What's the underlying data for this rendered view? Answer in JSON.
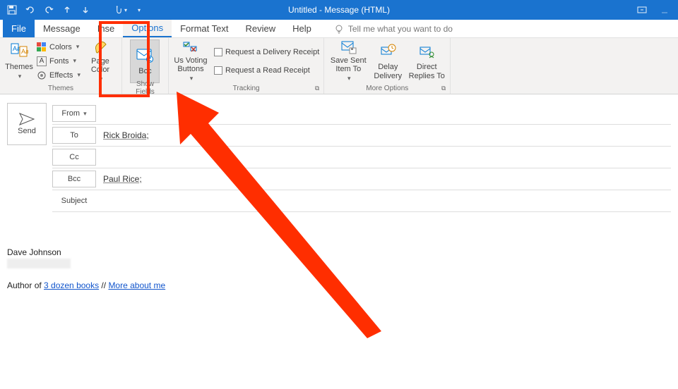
{
  "titlebar": {
    "title": "Untitled  -  Message (HTML)"
  },
  "tabs": {
    "file": "File",
    "message": "Message",
    "insert": "Inse",
    "options": "Options",
    "format": "Format Text",
    "review": "Review",
    "help": "Help",
    "tellme": "Tell me what you want to do"
  },
  "ribbon": {
    "themes": {
      "label": "Themes",
      "themesBtn": "Themes",
      "colors": "Colors",
      "fonts": "Fonts",
      "effects": "Effects",
      "pageColor": "Page Color"
    },
    "showFields": {
      "label": "Show Fields",
      "bcc": "Bcc"
    },
    "tracking": {
      "label": "Tracking",
      "voting": "Us   Voting Buttons",
      "delivery": "Request a Delivery Receipt",
      "read": "Request a Read Receipt"
    },
    "moreOptions": {
      "label": "More Options",
      "saveSent": "Save Sent Item To",
      "delay": "Delay Delivery",
      "direct": "Direct Replies To"
    }
  },
  "compose": {
    "send": "Send",
    "fromLabel": "From",
    "fromValue": "",
    "toLabel": "To",
    "toValue": "Rick Broida;",
    "ccLabel": "Cc",
    "ccValue": "",
    "bccLabel": "Bcc",
    "bccValue": "Paul Rice;",
    "subjectLabel": "Subject",
    "subjectValue": ""
  },
  "signature": {
    "name": "Dave Johnson",
    "authorPrefix": "Author of ",
    "link1": "3 dozen books",
    "sep": " // ",
    "link2": "More about me"
  },
  "colors": {
    "accent": "#1a73cf",
    "annotation": "#ff2e00"
  }
}
